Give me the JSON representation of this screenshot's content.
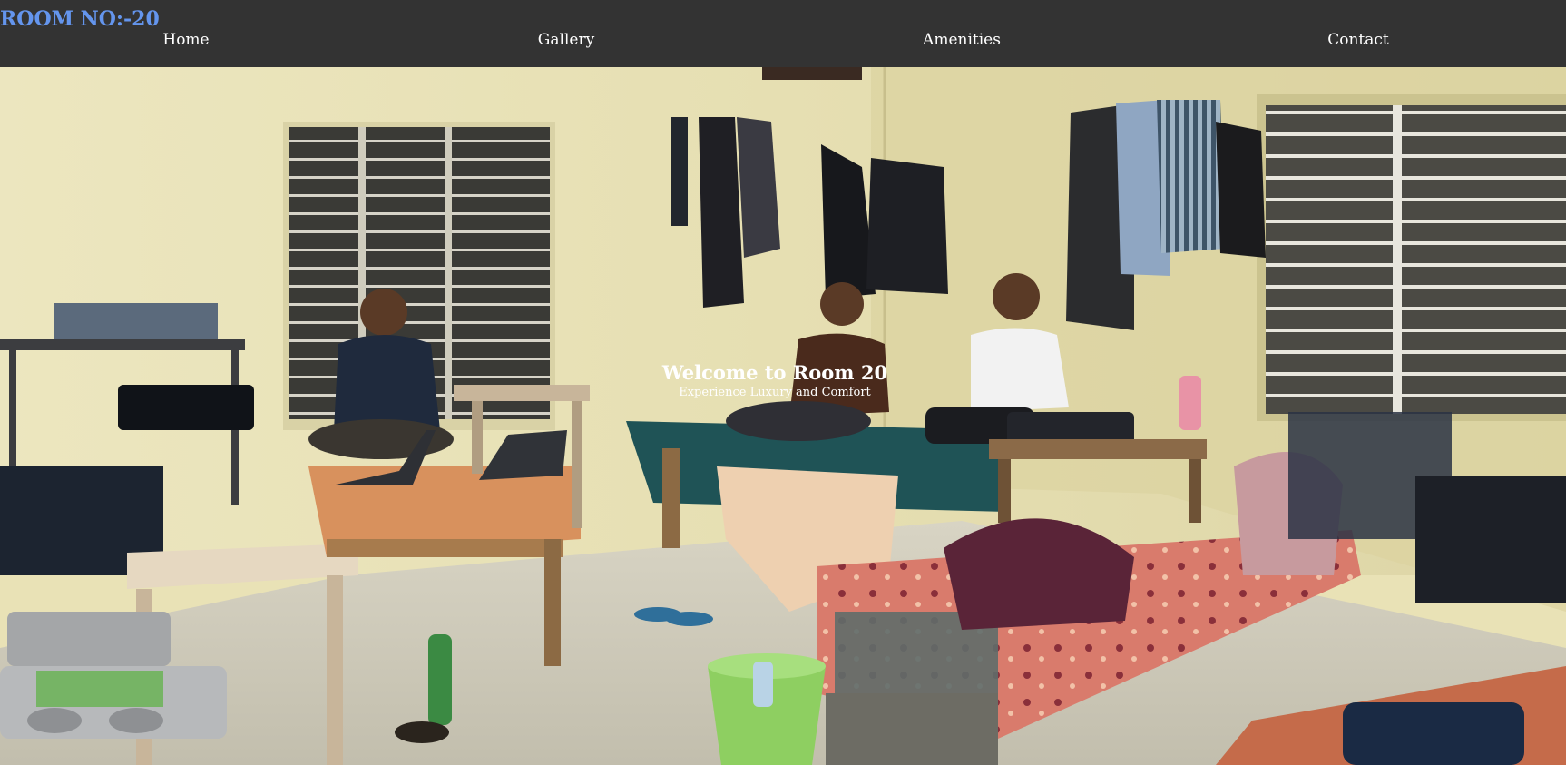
{
  "brand": {
    "title": "ROOM NO:-20"
  },
  "nav": {
    "items": [
      {
        "label": "Home"
      },
      {
        "label": "Gallery"
      },
      {
        "label": "Amenities"
      },
      {
        "label": "Contact"
      }
    ]
  },
  "hero": {
    "title": "Welcome to Room 20",
    "subtitle": "Experience Luxury and Comfort",
    "image": "hostel-room-photo"
  },
  "colors": {
    "header_bg": "#333333",
    "brand": "#6495ed",
    "nav_text": "#ffffff",
    "hero_text": "#ffffff"
  }
}
